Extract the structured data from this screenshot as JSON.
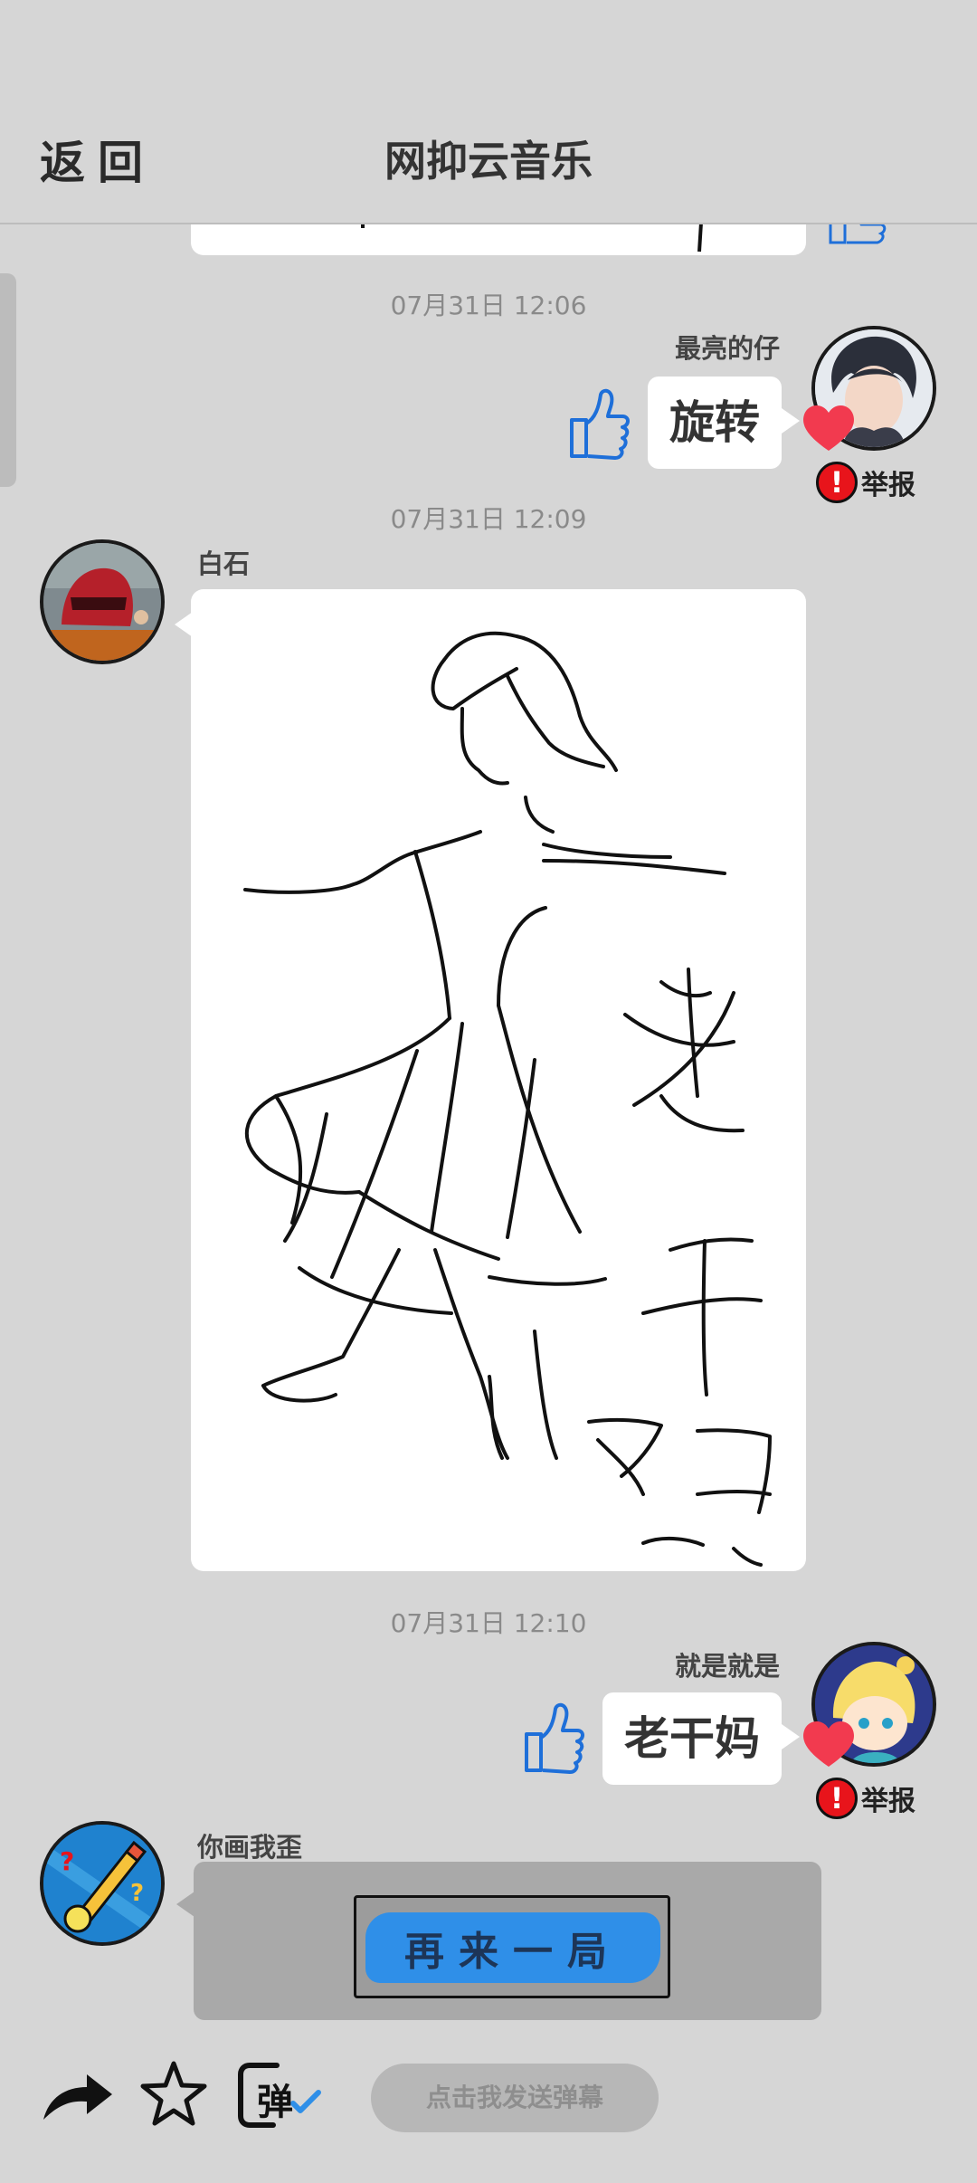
{
  "header": {
    "back_label": "返回",
    "title": "网抑云音乐"
  },
  "messages": [
    {
      "timestamp": "07月31日  12:06",
      "user": "最亮的仔",
      "text": "旋转",
      "report_label": "举报"
    },
    {
      "timestamp": "07月31日  12:09",
      "user": "白石",
      "content_type": "drawing",
      "drawing_text": "老干妈"
    },
    {
      "timestamp": "07月31日  12:10",
      "user": "就是就是",
      "text": "老干妈",
      "report_label": "举报"
    },
    {
      "user": "你画我歪",
      "button_label": "再来一局"
    }
  ],
  "toolbar": {
    "share_icon": "share-arrow-icon",
    "favorite_icon": "star-icon",
    "danmu_icon_label": "弹",
    "danmu_placeholder": "点击我发送弹幕"
  },
  "colors": {
    "background": "#d6d6d6",
    "accent_blue": "#2f8fe8",
    "report_red": "#e8141b",
    "heart_red": "#f23a4f",
    "like_blue": "#1e6fd9"
  }
}
